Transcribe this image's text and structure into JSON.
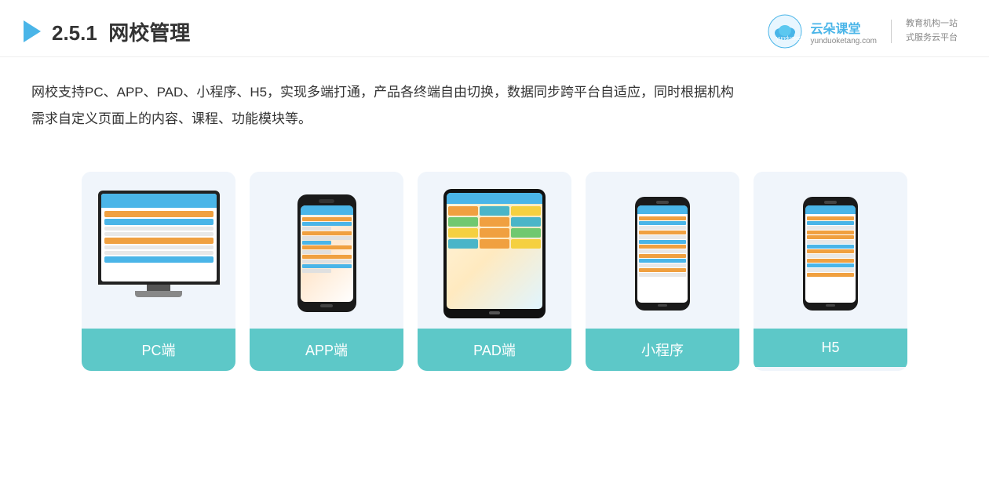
{
  "header": {
    "section_number": "2.5.1",
    "title": "网校管理",
    "brand_name": "云朵课堂",
    "brand_domain": "yunduoketang.com",
    "brand_slogan_line1": "教育机构一站",
    "brand_slogan_line2": "式服务云平台"
  },
  "description": {
    "text_line1": "网校支持PC、APP、PAD、小程序、H5，实现多端打通，产品各终端自由切换，数据同步跨平台自适应，同时根据机构",
    "text_line2": "需求自定义页面上的内容、课程、功能模块等。"
  },
  "cards": [
    {
      "id": "pc",
      "label": "PC端"
    },
    {
      "id": "app",
      "label": "APP端"
    },
    {
      "id": "pad",
      "label": "PAD端"
    },
    {
      "id": "miniapp",
      "label": "小程序"
    },
    {
      "id": "h5",
      "label": "H5"
    }
  ]
}
